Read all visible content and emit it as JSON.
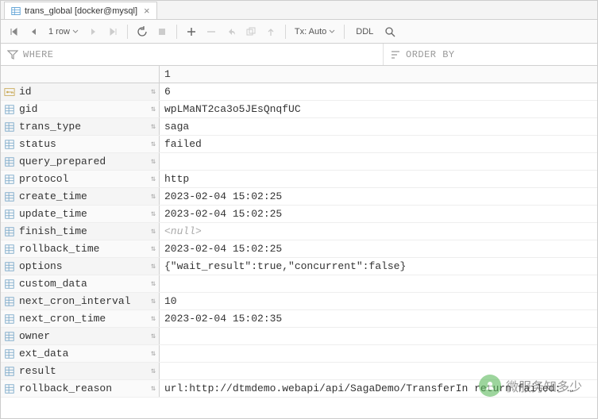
{
  "tab": {
    "title": "trans_global [docker@mysql]"
  },
  "toolbar": {
    "row_label": "1 row",
    "tx_label": "Tx: Auto",
    "ddl_label": "DDL"
  },
  "filter": {
    "where_label": "WHERE",
    "orderby_label": "ORDER BY"
  },
  "header": {
    "col_index": "1"
  },
  "rows": [
    {
      "name": "id",
      "value": "6",
      "icon": "pk"
    },
    {
      "name": "gid",
      "value": "wpLMaNT2ca3o5JEsQnqfUC",
      "icon": "col"
    },
    {
      "name": "trans_type",
      "value": "saga",
      "icon": "col"
    },
    {
      "name": "status",
      "value": "failed",
      "icon": "col"
    },
    {
      "name": "query_prepared",
      "value": "",
      "icon": "col"
    },
    {
      "name": "protocol",
      "value": "http",
      "icon": "col"
    },
    {
      "name": "create_time",
      "value": "2023-02-04 15:02:25",
      "icon": "col"
    },
    {
      "name": "update_time",
      "value": "2023-02-04 15:02:25",
      "icon": "col"
    },
    {
      "name": "finish_time",
      "value": "<null>",
      "icon": "col",
      "null": true
    },
    {
      "name": "rollback_time",
      "value": "2023-02-04 15:02:25",
      "icon": "col"
    },
    {
      "name": "options",
      "value": "{\"wait_result\":true,\"concurrent\":false}",
      "icon": "col"
    },
    {
      "name": "custom_data",
      "value": "",
      "icon": "col"
    },
    {
      "name": "next_cron_interval",
      "value": "10",
      "icon": "col"
    },
    {
      "name": "next_cron_time",
      "value": "2023-02-04 15:02:35",
      "icon": "col"
    },
    {
      "name": "owner",
      "value": "",
      "icon": "col"
    },
    {
      "name": "ext_data",
      "value": "",
      "icon": "col"
    },
    {
      "name": "result",
      "value": "",
      "icon": "col"
    },
    {
      "name": "rollback_reason",
      "value": "url:http://dtmdemo.webapi/api/SagaDemo/TransferIn return failed: …",
      "icon": "col"
    }
  ],
  "watermark": {
    "text": "微服务知多少"
  }
}
